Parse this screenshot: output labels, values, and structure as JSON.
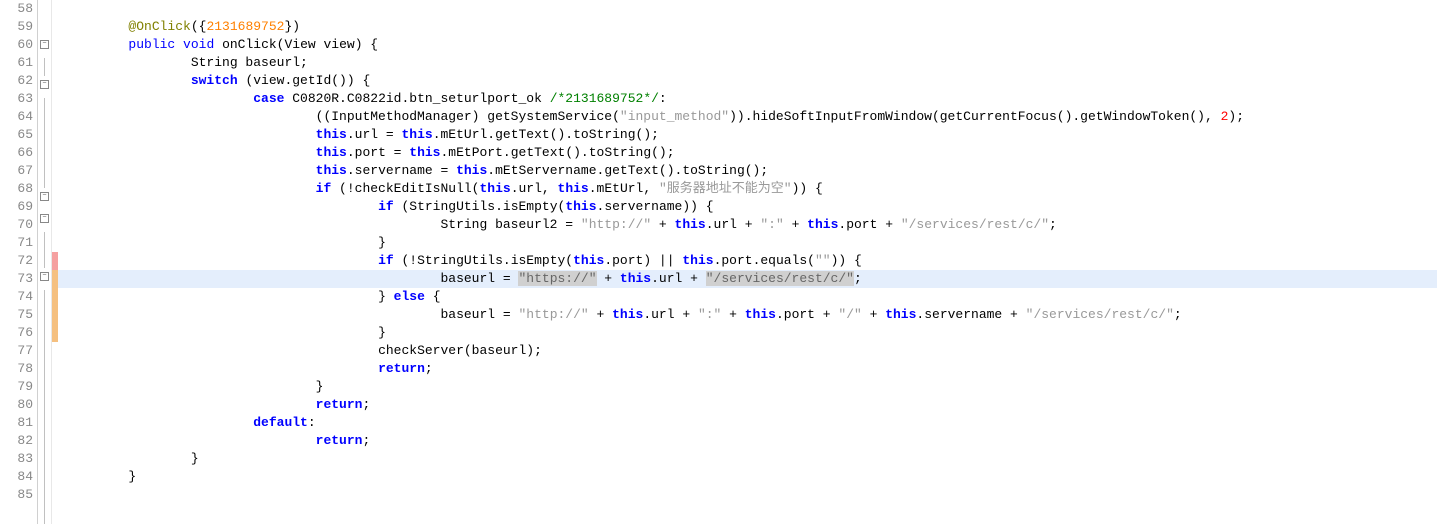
{
  "lines": [
    {
      "num": 58,
      "fold": "",
      "change": "",
      "hl": false,
      "tokens": []
    },
    {
      "num": 59,
      "fold": "",
      "change": "",
      "hl": false,
      "indent": 2,
      "tokens": [
        {
          "c": "k-annotation",
          "t": "@OnClick"
        },
        {
          "c": "k-normal",
          "t": "({"
        },
        {
          "c": "k-number",
          "t": "2131689752"
        },
        {
          "c": "k-normal",
          "t": "})"
        }
      ]
    },
    {
      "num": 60,
      "fold": "minus",
      "change": "",
      "hl": false,
      "indent": 2,
      "tokens": [
        {
          "c": "k-keyword",
          "t": "public"
        },
        {
          "c": "k-normal",
          "t": " "
        },
        {
          "c": "k-keyword",
          "t": "void"
        },
        {
          "c": "k-normal",
          "t": " onClick(View view) {"
        }
      ]
    },
    {
      "num": 61,
      "fold": "line",
      "change": "",
      "hl": false,
      "indent": 4,
      "tokens": [
        {
          "c": "k-normal",
          "t": "String baseurl;"
        }
      ]
    },
    {
      "num": 62,
      "fold": "minus",
      "change": "",
      "hl": false,
      "indent": 4,
      "tokens": [
        {
          "c": "k-keyword bold",
          "t": "switch"
        },
        {
          "c": "k-normal",
          "t": " (view.getId()) {"
        }
      ]
    },
    {
      "num": 63,
      "fold": "line",
      "change": "",
      "hl": false,
      "indent": 6,
      "tokens": [
        {
          "c": "k-keyword bold",
          "t": "case"
        },
        {
          "c": "k-normal",
          "t": " C0820R.C0822id.btn_seturlport_ok "
        },
        {
          "c": "k-comment",
          "t": "/*2131689752*/"
        },
        {
          "c": "k-normal",
          "t": ":"
        }
      ]
    },
    {
      "num": 64,
      "fold": "line",
      "change": "",
      "hl": false,
      "indent": 8,
      "tokens": [
        {
          "c": "k-normal",
          "t": "((InputMethodManager) getSystemService("
        },
        {
          "c": "k-string",
          "t": "\"input_method\""
        },
        {
          "c": "k-normal",
          "t": ")).hideSoftInputFromWindow(getCurrentFocus().getWindowToken(), "
        },
        {
          "c": "param-num",
          "t": "2"
        },
        {
          "c": "k-normal",
          "t": ");"
        }
      ]
    },
    {
      "num": 65,
      "fold": "line",
      "change": "",
      "hl": false,
      "indent": 8,
      "tokens": [
        {
          "c": "k-keyword bold",
          "t": "this"
        },
        {
          "c": "k-normal",
          "t": ".url = "
        },
        {
          "c": "k-keyword bold",
          "t": "this"
        },
        {
          "c": "k-normal",
          "t": ".mEtUrl.getText().toString();"
        }
      ]
    },
    {
      "num": 66,
      "fold": "line",
      "change": "",
      "hl": false,
      "indent": 8,
      "tokens": [
        {
          "c": "k-keyword bold",
          "t": "this"
        },
        {
          "c": "k-normal",
          "t": ".port = "
        },
        {
          "c": "k-keyword bold",
          "t": "this"
        },
        {
          "c": "k-normal",
          "t": ".mEtPort.getText().toString();"
        }
      ]
    },
    {
      "num": 67,
      "fold": "line",
      "change": "",
      "hl": false,
      "indent": 8,
      "tokens": [
        {
          "c": "k-keyword bold",
          "t": "this"
        },
        {
          "c": "k-normal",
          "t": ".servername = "
        },
        {
          "c": "k-keyword bold",
          "t": "this"
        },
        {
          "c": "k-normal",
          "t": ".mEtServername.getText().toString();"
        }
      ]
    },
    {
      "num": 68,
      "fold": "minus",
      "change": "",
      "hl": false,
      "indent": 8,
      "tokens": [
        {
          "c": "k-keyword bold",
          "t": "if"
        },
        {
          "c": "k-normal",
          "t": " (!checkEditIsNull("
        },
        {
          "c": "k-keyword bold",
          "t": "this"
        },
        {
          "c": "k-normal",
          "t": ".url, "
        },
        {
          "c": "k-keyword bold",
          "t": "this"
        },
        {
          "c": "k-normal",
          "t": ".mEtUrl, "
        },
        {
          "c": "k-string",
          "t": "\"服务器地址不能为空\""
        },
        {
          "c": "k-normal",
          "t": ")) {"
        }
      ]
    },
    {
      "num": 69,
      "fold": "minus",
      "change": "",
      "hl": false,
      "indent": 10,
      "tokens": [
        {
          "c": "k-keyword bold",
          "t": "if"
        },
        {
          "c": "k-normal",
          "t": " (StringUtils.isEmpty("
        },
        {
          "c": "k-keyword bold",
          "t": "this"
        },
        {
          "c": "k-normal",
          "t": ".servername)) {"
        }
      ]
    },
    {
      "num": 70,
      "fold": "line",
      "change": "",
      "hl": false,
      "indent": 12,
      "tokens": [
        {
          "c": "k-normal",
          "t": "String baseurl2 = "
        },
        {
          "c": "k-string",
          "t": "\"http://\""
        },
        {
          "c": "k-normal",
          "t": " + "
        },
        {
          "c": "k-keyword bold",
          "t": "this"
        },
        {
          "c": "k-normal",
          "t": ".url + "
        },
        {
          "c": "k-string",
          "t": "\":\""
        },
        {
          "c": "k-normal",
          "t": " + "
        },
        {
          "c": "k-keyword bold",
          "t": "this"
        },
        {
          "c": "k-normal",
          "t": ".port + "
        },
        {
          "c": "k-string",
          "t": "\"/services/rest/c/\""
        },
        {
          "c": "k-normal",
          "t": ";"
        }
      ]
    },
    {
      "num": 71,
      "fold": "line",
      "change": "",
      "hl": false,
      "indent": 10,
      "tokens": [
        {
          "c": "k-normal",
          "t": "}"
        }
      ]
    },
    {
      "num": 72,
      "fold": "minus",
      "change": "red",
      "hl": false,
      "indent": 10,
      "tokens": [
        {
          "c": "k-keyword bold",
          "t": "if"
        },
        {
          "c": "k-normal",
          "t": " (!StringUtils.isEmpty("
        },
        {
          "c": "k-keyword bold",
          "t": "this"
        },
        {
          "c": "k-normal",
          "t": ".port) || "
        },
        {
          "c": "k-keyword bold",
          "t": "this"
        },
        {
          "c": "k-normal",
          "t": ".port.equals("
        },
        {
          "c": "k-string",
          "t": "\"\""
        },
        {
          "c": "k-normal",
          "t": ")) {"
        }
      ]
    },
    {
      "num": 73,
      "fold": "line",
      "change": "orange",
      "hl": true,
      "indent": 12,
      "tokens": [
        {
          "c": "k-normal",
          "t": "baseurl = "
        },
        {
          "c": "selected-str",
          "t": "\"https://\""
        },
        {
          "c": "k-normal",
          "t": " + "
        },
        {
          "c": "k-keyword bold",
          "t": "this"
        },
        {
          "c": "k-normal",
          "t": ".url + "
        },
        {
          "c": "selected-str",
          "t": "\"/services/rest/c/\""
        },
        {
          "c": "k-normal",
          "t": ";"
        }
      ]
    },
    {
      "num": 74,
      "fold": "line",
      "change": "orange",
      "hl": false,
      "indent": 10,
      "tokens": [
        {
          "c": "k-normal",
          "t": "} "
        },
        {
          "c": "k-keyword bold",
          "t": "else"
        },
        {
          "c": "k-normal",
          "t": " {"
        }
      ]
    },
    {
      "num": 75,
      "fold": "line",
      "change": "orange",
      "hl": false,
      "indent": 12,
      "tokens": [
        {
          "c": "k-normal",
          "t": "baseurl = "
        },
        {
          "c": "k-string",
          "t": "\"http://\""
        },
        {
          "c": "k-normal",
          "t": " + "
        },
        {
          "c": "k-keyword bold",
          "t": "this"
        },
        {
          "c": "k-normal",
          "t": ".url + "
        },
        {
          "c": "k-string",
          "t": "\":\""
        },
        {
          "c": "k-normal",
          "t": " + "
        },
        {
          "c": "k-keyword bold",
          "t": "this"
        },
        {
          "c": "k-normal",
          "t": ".port + "
        },
        {
          "c": "k-string",
          "t": "\"/\""
        },
        {
          "c": "k-normal",
          "t": " + "
        },
        {
          "c": "k-keyword bold",
          "t": "this"
        },
        {
          "c": "k-normal",
          "t": ".servername + "
        },
        {
          "c": "k-string",
          "t": "\"/services/rest/c/\""
        },
        {
          "c": "k-normal",
          "t": ";"
        }
      ]
    },
    {
      "num": 76,
      "fold": "line",
      "change": "orange",
      "hl": false,
      "indent": 10,
      "tokens": [
        {
          "c": "k-normal",
          "t": "}"
        }
      ]
    },
    {
      "num": 77,
      "fold": "line",
      "change": "",
      "hl": false,
      "indent": 10,
      "tokens": [
        {
          "c": "k-normal",
          "t": "checkServer(baseurl);"
        }
      ]
    },
    {
      "num": 78,
      "fold": "line",
      "change": "",
      "hl": false,
      "indent": 10,
      "tokens": [
        {
          "c": "k-keyword bold",
          "t": "return"
        },
        {
          "c": "k-normal",
          "t": ";"
        }
      ]
    },
    {
      "num": 79,
      "fold": "line",
      "change": "",
      "hl": false,
      "indent": 8,
      "tokens": [
        {
          "c": "k-normal",
          "t": "}"
        }
      ]
    },
    {
      "num": 80,
      "fold": "line",
      "change": "",
      "hl": false,
      "indent": 8,
      "tokens": [
        {
          "c": "k-keyword bold",
          "t": "return"
        },
        {
          "c": "k-normal",
          "t": ";"
        }
      ]
    },
    {
      "num": 81,
      "fold": "line",
      "change": "",
      "hl": false,
      "indent": 6,
      "tokens": [
        {
          "c": "k-keyword bold",
          "t": "default"
        },
        {
          "c": "k-normal",
          "t": ":"
        }
      ]
    },
    {
      "num": 82,
      "fold": "line",
      "change": "",
      "hl": false,
      "indent": 8,
      "tokens": [
        {
          "c": "k-keyword bold",
          "t": "return"
        },
        {
          "c": "k-normal",
          "t": ";"
        }
      ]
    },
    {
      "num": 83,
      "fold": "line",
      "change": "",
      "hl": false,
      "indent": 4,
      "tokens": [
        {
          "c": "k-normal",
          "t": "}"
        }
      ]
    },
    {
      "num": 84,
      "fold": "line",
      "change": "",
      "hl": false,
      "indent": 2,
      "tokens": [
        {
          "c": "k-normal",
          "t": "}"
        }
      ]
    },
    {
      "num": 85,
      "fold": "line",
      "change": "",
      "hl": false,
      "indent": 0,
      "tokens": []
    }
  ],
  "indent_unit": "    "
}
